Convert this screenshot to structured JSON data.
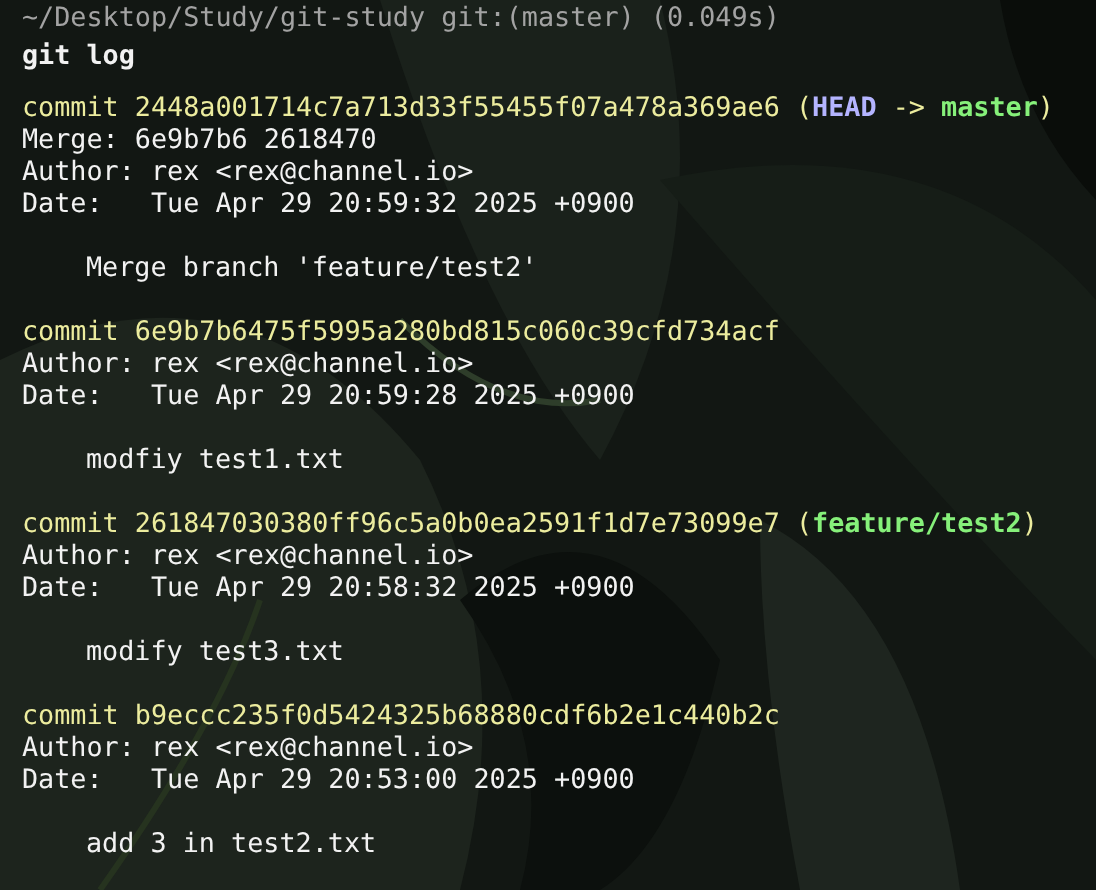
{
  "terminal": {
    "lines": [
      {
        "kind": "prompt",
        "text": "~/Desktop/Study/git-study git:(master) (0.049s)"
      },
      {
        "kind": "command",
        "text": "git log"
      },
      {
        "kind": "commit",
        "segments": [
          {
            "kind": "hash",
            "text": "commit 2448a001714c7a713d33f55455f07a478a369ae6 ("
          },
          {
            "kind": "head",
            "text": "HEAD"
          },
          {
            "kind": "hash",
            "text": " -> "
          },
          {
            "kind": "branch",
            "text": "master"
          },
          {
            "kind": "hash",
            "text": ")"
          }
        ]
      },
      {
        "kind": "header",
        "text": "Merge: 6e9b7b6 2618470"
      },
      {
        "kind": "header",
        "text": "Author: rex <rex@channel.io>"
      },
      {
        "kind": "header",
        "text": "Date:   Tue Apr 29 20:59:32 2025 +0900"
      },
      {
        "kind": "blank"
      },
      {
        "kind": "message",
        "text": "Merge branch 'feature/test2'"
      },
      {
        "kind": "blank"
      },
      {
        "kind": "commit",
        "segments": [
          {
            "kind": "hash",
            "text": "commit 6e9b7b6475f5995a280bd815c060c39cfd734acf"
          }
        ]
      },
      {
        "kind": "header",
        "text": "Author: rex <rex@channel.io>"
      },
      {
        "kind": "header",
        "text": "Date:   Tue Apr 29 20:59:28 2025 +0900"
      },
      {
        "kind": "blank"
      },
      {
        "kind": "message",
        "text": "modfiy test1.txt"
      },
      {
        "kind": "blank"
      },
      {
        "kind": "commit",
        "segments": [
          {
            "kind": "hash",
            "text": "commit 261847030380ff96c5a0b0ea2591f1d7e73099e7 ("
          },
          {
            "kind": "branch",
            "text": "feature/test2"
          },
          {
            "kind": "hash",
            "text": ")"
          }
        ]
      },
      {
        "kind": "header",
        "text": "Author: rex <rex@channel.io>"
      },
      {
        "kind": "header",
        "text": "Date:   Tue Apr 29 20:58:32 2025 +0900"
      },
      {
        "kind": "blank"
      },
      {
        "kind": "message",
        "text": "modify test3.txt"
      },
      {
        "kind": "blank"
      },
      {
        "kind": "commit",
        "segments": [
          {
            "kind": "hash",
            "text": "commit b9eccc235f0d5424325b68880cdf6b2e1c440b2c"
          }
        ]
      },
      {
        "kind": "header",
        "text": "Author: rex <rex@channel.io>"
      },
      {
        "kind": "header",
        "text": "Date:   Tue Apr 29 20:53:00 2025 +0900"
      },
      {
        "kind": "blank"
      },
      {
        "kind": "message",
        "text": "add 3 in test2.txt"
      }
    ]
  }
}
